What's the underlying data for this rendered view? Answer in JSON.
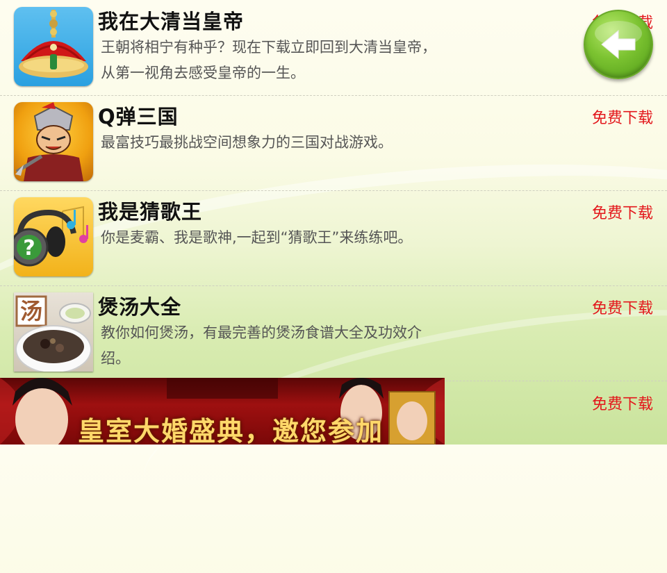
{
  "apps": [
    {
      "title": "我在大清当皇帝",
      "desc": "王朝将相宁有种乎？现在下载立即回到大清当皇帝，从第一视角去感受皇帝的一生。",
      "download": "免费下载",
      "icon": "emperor-hat-icon"
    },
    {
      "title": "Q弹三国",
      "desc": "最富技巧最挑战空间想象力的三国对战游戏。",
      "download": "免费下载",
      "icon": "warrior-icon"
    },
    {
      "title": "我是猜歌王",
      "desc": "你是麦霸、我是歌神,一起到“猜歌王”来练练吧。",
      "download": "免费下载",
      "icon": "headphones-music-icon"
    },
    {
      "title": "煲汤大全",
      "desc": "教你如何煲汤，有最完善的煲汤食谱大全及功效介绍。",
      "download": "免费下载",
      "icon": "soup-bowl-icon",
      "badge": "汤"
    }
  ],
  "banner": {
    "text": "皇室大婚盛典，邀您参加",
    "download": "免费下载"
  },
  "back_button": {
    "icon": "back-arrow-icon"
  }
}
